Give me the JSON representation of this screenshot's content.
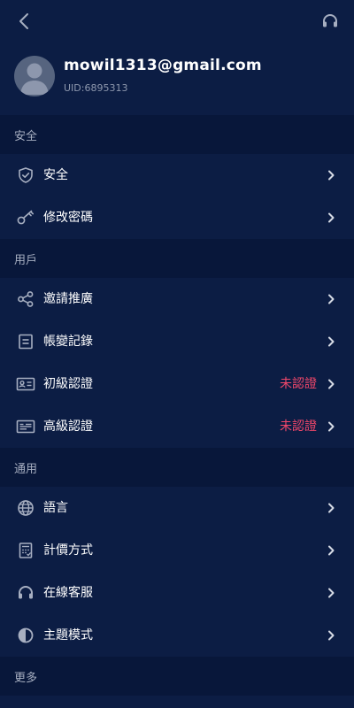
{
  "topbar": {
    "back_icon": "chevron-left-icon",
    "support_icon": "headset-icon"
  },
  "profile": {
    "email": "mowil1313@gmail.com",
    "uid": "UID:6895313"
  },
  "sections": {
    "security": {
      "header": "安全",
      "items": [
        {
          "label": "安全",
          "icon": "shield-check-icon"
        },
        {
          "label": "修改密碼",
          "icon": "key-icon"
        }
      ]
    },
    "user": {
      "header": "用戶",
      "items": [
        {
          "label": "邀請推廣",
          "icon": "share-icon"
        },
        {
          "label": "帳變記錄",
          "icon": "ledger-icon"
        },
        {
          "label": "初級認證",
          "icon": "id-card-icon",
          "status": "未認證"
        },
        {
          "label": "高級認證",
          "icon": "id-card-advanced-icon",
          "status": "未認證"
        }
      ]
    },
    "general": {
      "header": "通用",
      "items": [
        {
          "label": "語言",
          "icon": "globe-icon"
        },
        {
          "label": "計價方式",
          "icon": "calculator-icon"
        },
        {
          "label": "在線客服",
          "icon": "headset-icon"
        },
        {
          "label": "主題模式",
          "icon": "contrast-icon"
        }
      ]
    },
    "more": {
      "header": "更多"
    }
  },
  "colors": {
    "background": "#0c1d44",
    "section_background": "#08173a",
    "status_red": "#f0476a",
    "icon_gray": "#a7afc1"
  }
}
